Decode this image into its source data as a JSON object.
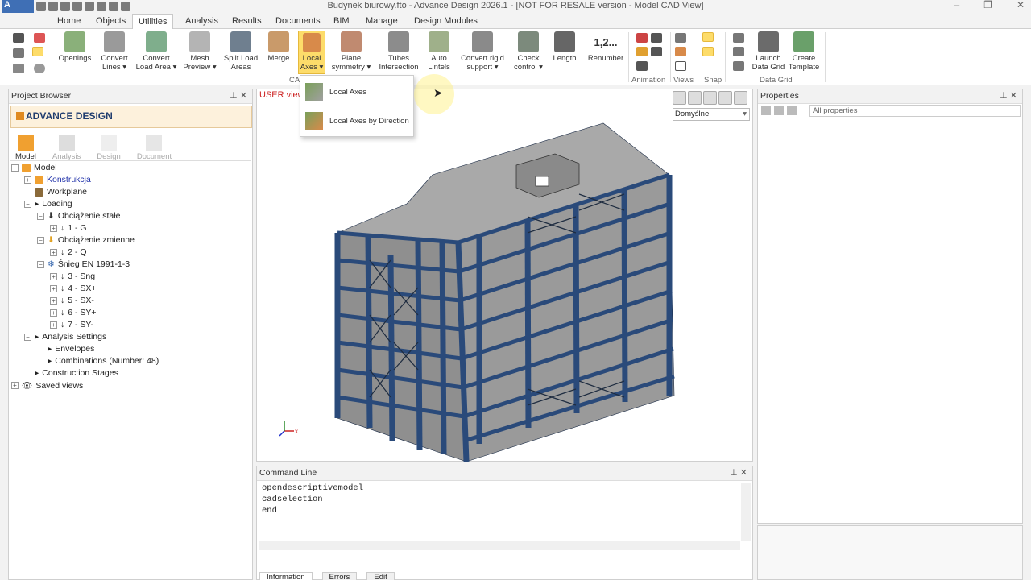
{
  "title_bar": {
    "app_button": "A",
    "title": "Budynek biurowy.fto - Advance Design 2026.1 - [NOT FOR RESALE version - Model CAD View]"
  },
  "tabs": [
    "Home",
    "Objects",
    "Utilities",
    "Analysis",
    "Results",
    "Documents",
    "BIM",
    "Manage",
    "Design Modules"
  ],
  "active_tab": "Utilities",
  "ribbon": {
    "buttons": [
      {
        "label": "Openings",
        "label2": ""
      },
      {
        "label": "Convert",
        "label2": "Lines ▾"
      },
      {
        "label": "Convert",
        "label2": "Load Area ▾"
      },
      {
        "label": "Mesh",
        "label2": "Preview ▾"
      },
      {
        "label": "Split Load",
        "label2": "Areas"
      },
      {
        "label": "Merge",
        "label2": ""
      },
      {
        "label": "Local",
        "label2": "Axes ▾"
      },
      {
        "label": "Plane",
        "label2": "symmetry ▾"
      },
      {
        "label": "Tubes",
        "label2": "Intersection"
      },
      {
        "label": "Auto",
        "label2": "Lintels"
      },
      {
        "label": "Convert rigid",
        "label2": "support ▾"
      },
      {
        "label": "Check",
        "label2": "control ▾"
      },
      {
        "label": "Length",
        "label2": ""
      },
      {
        "label": "Renumber",
        "label2": ""
      },
      {
        "label": "Launch",
        "label2": "Data Grid"
      },
      {
        "label": "Create",
        "label2": "Template"
      }
    ],
    "renumber_glyph": "1,2...",
    "groups": [
      "CA",
      "Animation",
      "Views",
      "Snap",
      "Data Grid"
    ]
  },
  "local_axes_menu": {
    "items": [
      "Local Axes",
      "Local Axes by Direction"
    ]
  },
  "project_browser": {
    "header": "Project Browser",
    "logo": "ADVANCE DESIGN",
    "mode_tabs": [
      "Model",
      "Analysis",
      "Design",
      "Document"
    ],
    "tree": [
      {
        "label": "Model",
        "level": 0
      },
      {
        "label": "Konstrukcja",
        "level": 1
      },
      {
        "label": "Workplane",
        "level": 1
      },
      {
        "label": "Loading",
        "level": 1
      },
      {
        "label": "Obciążenie stałe",
        "level": 2
      },
      {
        "label": "1 - G",
        "level": 3
      },
      {
        "label": "Obciążenie zmienne",
        "level": 2
      },
      {
        "label": "2 - Q",
        "level": 3
      },
      {
        "label": "Śnieg EN 1991-1-3",
        "level": 2
      },
      {
        "label": "3 - Sng",
        "level": 3
      },
      {
        "label": "4 - SX+",
        "level": 3
      },
      {
        "label": "5 - SX-",
        "level": 3
      },
      {
        "label": "6 - SY+",
        "level": 3
      },
      {
        "label": "7 - SY-",
        "level": 3
      },
      {
        "label": "Analysis Settings",
        "level": 1
      },
      {
        "label": "Envelopes",
        "level": 2
      },
      {
        "label": "Combinations (Number: 48)",
        "level": 2
      },
      {
        "label": "Construction Stages",
        "level": 1
      },
      {
        "label": "Saved views",
        "level": 0
      }
    ]
  },
  "viewport": {
    "view_label": "USER view",
    "style_select": "Domyślne",
    "axis_label": "x"
  },
  "properties": {
    "header": "Properties",
    "filter_select": "All properties"
  },
  "command_line": {
    "header": "Command Line",
    "lines": [
      "opendescriptivemodel",
      "cadselection",
      "end"
    ],
    "tabs": [
      "Information",
      "Errors",
      "Edit"
    ]
  },
  "colors": {
    "accent_yellow": "#fddc6a",
    "frame_blue": "#2a4a7a",
    "slab_gray": "#9b9b9b",
    "view_label_red": "#cc2222",
    "tree_blue_text": "#2233aa"
  }
}
